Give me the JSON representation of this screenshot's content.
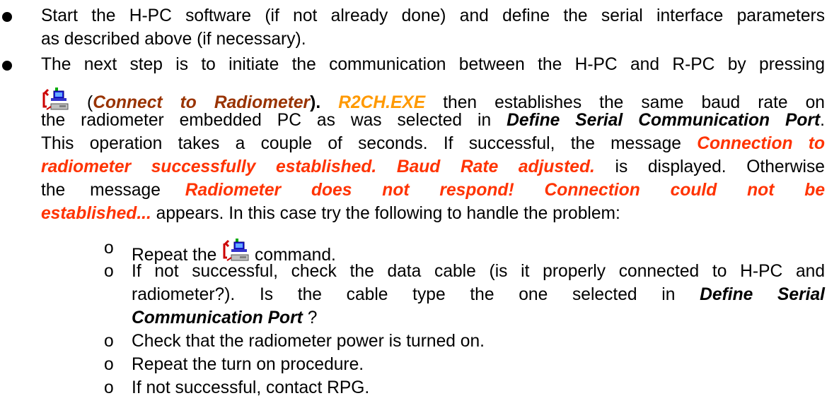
{
  "colors": {
    "connect_label": "#993300",
    "exe_name": "#FF9900",
    "message": "#FF3300",
    "text": "#000000"
  },
  "bullet1": {
    "line1": "Start the H-PC software (if not already done) and define the serial interface parameters",
    "line2": "as described above (if necessary)."
  },
  "bullet2": {
    "line1": "The next step is to initiate the communication between the H-PC and R-PC by pressing",
    "paren_open": "(",
    "connect_label": "Connect to Radiometer",
    "paren_close": ").",
    "exe_name": "R2CH.EXE",
    "line2_rest": "then establishes the same baud rate on",
    "line3_pre": "the radiometer embedded PC as was selected in",
    "define_port_1": "Define Serial Communication Port",
    "line3_post": ".",
    "line4_pre": "This operation takes a couple of seconds. If successful, the message",
    "msg_success_a": "Connection to",
    "msg_success_b": "radiometer successfully established. Baud Rate adjusted.",
    "line5_post": "is displayed. Otherwise",
    "line6_pre": "the message",
    "msg_fail_a": "Radiometer does not respond! Connection could not be",
    "msg_fail_b": "established...",
    "line7_post": "appears. In this case try the following to handle the problem:"
  },
  "subitems": {
    "bullet_char": "o",
    "item1_pre": "Repeat the",
    "item1_post": "command.",
    "item2_line1": "If not successful, check the data cable (is it properly connected to H-PC and",
    "item2_line2_pre": "radiometer?). Is the cable type the one selected in",
    "define_port_a": "Define Serial",
    "define_port_b": "Communication Port",
    "item2_line3_post": "?",
    "item3": "Check that the radiometer power is turned on.",
    "item4": "Repeat the turn on procedure.",
    "item5": "If not successful, contact RPG."
  },
  "icons": {
    "connect_button": "connect-to-radiometer-icon"
  }
}
